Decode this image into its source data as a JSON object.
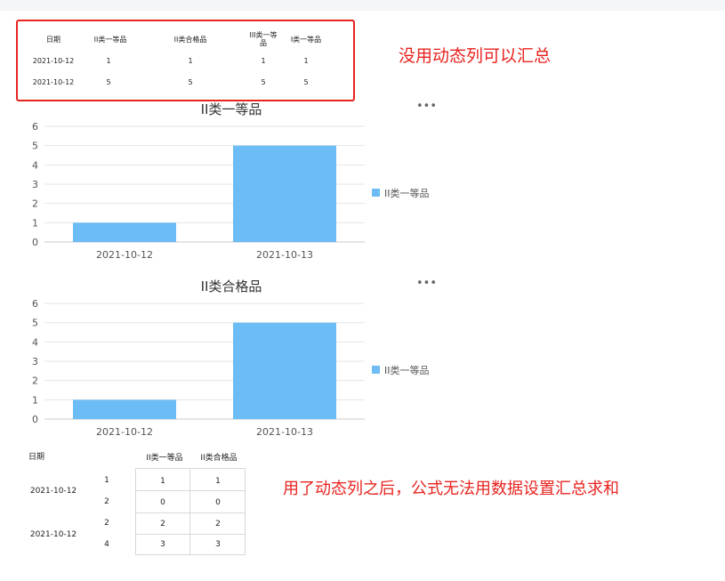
{
  "top_table": {
    "headers": [
      "日期",
      "II类一等品",
      "II类合格品",
      "III类一等品",
      "I类一等品"
    ],
    "rows": [
      {
        "date": "2021-10-12",
        "values": [
          "1",
          "1",
          "1",
          "1"
        ]
      },
      {
        "date": "2021-10-12",
        "values": [
          "5",
          "5",
          "5",
          "5"
        ]
      }
    ]
  },
  "notes": {
    "note1": "没用动态列可以汇总",
    "note2": "用了动态列之后，公式无法用数据设置汇总求和"
  },
  "chart_data": [
    {
      "type": "bar",
      "title": "II类一等品",
      "categories": [
        "2021-10-12",
        "2021-10-13"
      ],
      "series": [
        {
          "name": "II类一等品",
          "values": [
            1,
            5
          ]
        }
      ],
      "ylim": [
        0,
        6
      ],
      "yticks": [
        "0",
        "1",
        "2",
        "3",
        "4",
        "5",
        "6"
      ],
      "grid": true,
      "legend": "right",
      "color": "#6cbcf5"
    },
    {
      "type": "bar",
      "title": "II类合格品",
      "categories": [
        "2021-10-12",
        "2021-10-13"
      ],
      "series": [
        {
          "name": "II类一等品",
          "values": [
            1,
            5
          ]
        }
      ],
      "ylim": [
        0,
        6
      ],
      "yticks": [
        "0",
        "1",
        "2",
        "3",
        "4",
        "5",
        "6"
      ],
      "grid": true,
      "legend": "right",
      "color": "#6cbcf5"
    }
  ],
  "bottom_table": {
    "date_header": "日期",
    "col_headers": [
      "II类一等品",
      "II类合格品"
    ],
    "groups": [
      {
        "date": "2021-10-12",
        "rows": [
          {
            "label": "1",
            "values": [
              "1",
              "1"
            ]
          },
          {
            "label": "2",
            "values": [
              "0",
              "0"
            ]
          }
        ]
      },
      {
        "date": "2021-10-12",
        "rows": [
          {
            "label": "2",
            "values": [
              "2",
              "2"
            ]
          },
          {
            "label": "4",
            "values": [
              "3",
              "3"
            ]
          }
        ]
      }
    ]
  },
  "icons": {
    "more": "more-horizontal-icon"
  }
}
